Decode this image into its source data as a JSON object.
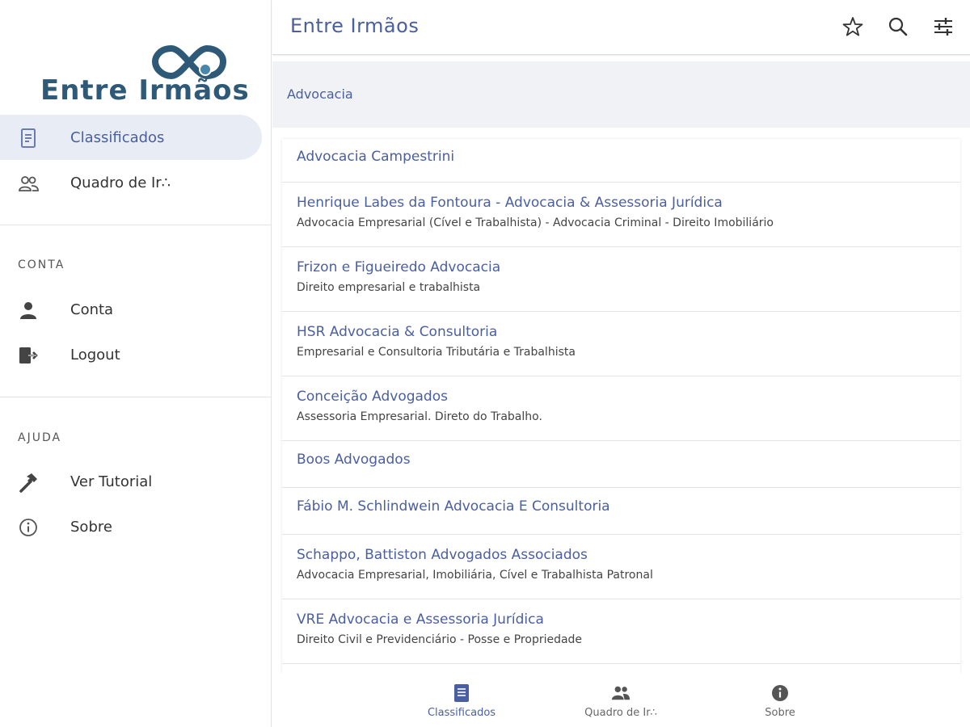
{
  "app": {
    "title": "Entre Irmãos",
    "logo_text": "Entre Irmãos"
  },
  "sidebar": {
    "main_items": [
      {
        "label": "Classificados",
        "icon": "document-icon",
        "active": true
      },
      {
        "label": "Quadro de Ir∴",
        "icon": "group-icon",
        "active": false
      }
    ],
    "sections": [
      {
        "title": "CONTA",
        "items": [
          {
            "label": "Conta",
            "icon": "person-icon"
          },
          {
            "label": "Logout",
            "icon": "logout-icon"
          }
        ]
      },
      {
        "title": "AJUDA",
        "items": [
          {
            "label": "Ver Tutorial",
            "icon": "hammer-icon"
          },
          {
            "label": "Sobre",
            "icon": "info-icon"
          }
        ]
      }
    ]
  },
  "header": {
    "title": "Entre Irmãos",
    "icons": [
      "star-icon",
      "search-icon",
      "filter-icon"
    ]
  },
  "category": "Advocacia",
  "listings": [
    {
      "name": "Advocacia Campestrini",
      "desc": ""
    },
    {
      "name": "Henrique Labes da Fontoura - Advocacia & Assessoria Jurídica",
      "desc": "Advocacia Empresarial (Cível e Trabalhista) - Advocacia Criminal - Direito Imobiliário"
    },
    {
      "name": "Frizon e Figueiredo Advocacia",
      "desc": "Direito empresarial e trabalhista"
    },
    {
      "name": "HSR Advocacia & Consultoria",
      "desc": "Empresarial e Consultoria Tributária e Trabalhista"
    },
    {
      "name": "Conceição Advogados",
      "desc": "Assessoria Empresarial. Direto do Trabalho."
    },
    {
      "name": "Boos Advogados",
      "desc": ""
    },
    {
      "name": "Fábio M. Schlindwein Advocacia E Consultoria",
      "desc": ""
    },
    {
      "name": "Schappo, Battiston Advogados Associados",
      "desc": "Advocacia Empresarial, Imobiliária, Cível e Trabalhista Patronal"
    },
    {
      "name": "VRE Advocacia e Assessoria Jurídica",
      "desc": "Direito Civil e Previdenciário - Posse e Propriedade"
    }
  ],
  "tabs": [
    {
      "label": "Classificados",
      "icon": "document-icon",
      "active": true
    },
    {
      "label": "Quadro de Ir∴",
      "icon": "group-icon",
      "active": false
    },
    {
      "label": "Sobre",
      "icon": "info-icon",
      "active": false
    }
  ],
  "colors": {
    "accent": "#4a5fa0",
    "logo": "#2f5a77",
    "active_bg": "#e8ecf4"
  }
}
